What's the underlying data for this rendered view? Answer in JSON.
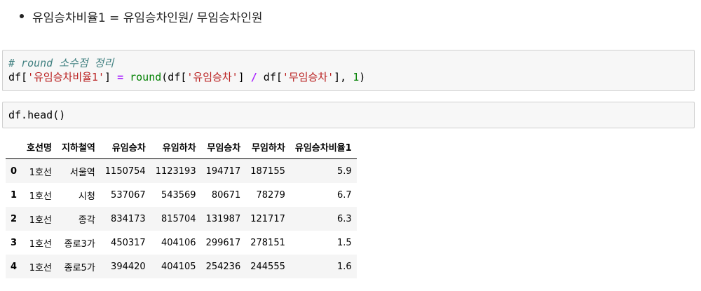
{
  "markdown": {
    "bullet_text": "유임승차비율1 = 유임승차인원/ 무임승차인원"
  },
  "cell1": {
    "comment": "# round 소수점 정리",
    "line2": {
      "df1": "df[",
      "str1": "'유임승차비율1'",
      "close1": "] ",
      "eq": "=",
      "sp1": " ",
      "round": "round",
      "df2": "(df[",
      "str2": "'유임승차'",
      "close2": "] ",
      "div": "/",
      "df3": " df[",
      "str3": "'무임승차'",
      "close3": "], ",
      "num": "1",
      "paren": ")"
    }
  },
  "cell2": {
    "code": "df.head()"
  },
  "table": {
    "index_header": "",
    "columns": [
      "호선명",
      "지하철역",
      "유임승차",
      "유임하차",
      "무임승차",
      "무임하차",
      "유임승차비율1"
    ],
    "rows": [
      {
        "index": "0",
        "cells": [
          "1호선",
          "서울역",
          "1150754",
          "1123193",
          "194717",
          "187155",
          "5.9"
        ]
      },
      {
        "index": "1",
        "cells": [
          "1호선",
          "시청",
          "537067",
          "543569",
          "80671",
          "78279",
          "6.7"
        ]
      },
      {
        "index": "2",
        "cells": [
          "1호선",
          "종각",
          "834173",
          "815704",
          "131987",
          "121717",
          "6.3"
        ]
      },
      {
        "index": "3",
        "cells": [
          "1호선",
          "종로3가",
          "450317",
          "404106",
          "299617",
          "278151",
          "1.5"
        ]
      },
      {
        "index": "4",
        "cells": [
          "1호선",
          "종로5가",
          "394420",
          "404105",
          "254236",
          "244555",
          "1.6"
        ]
      }
    ]
  }
}
